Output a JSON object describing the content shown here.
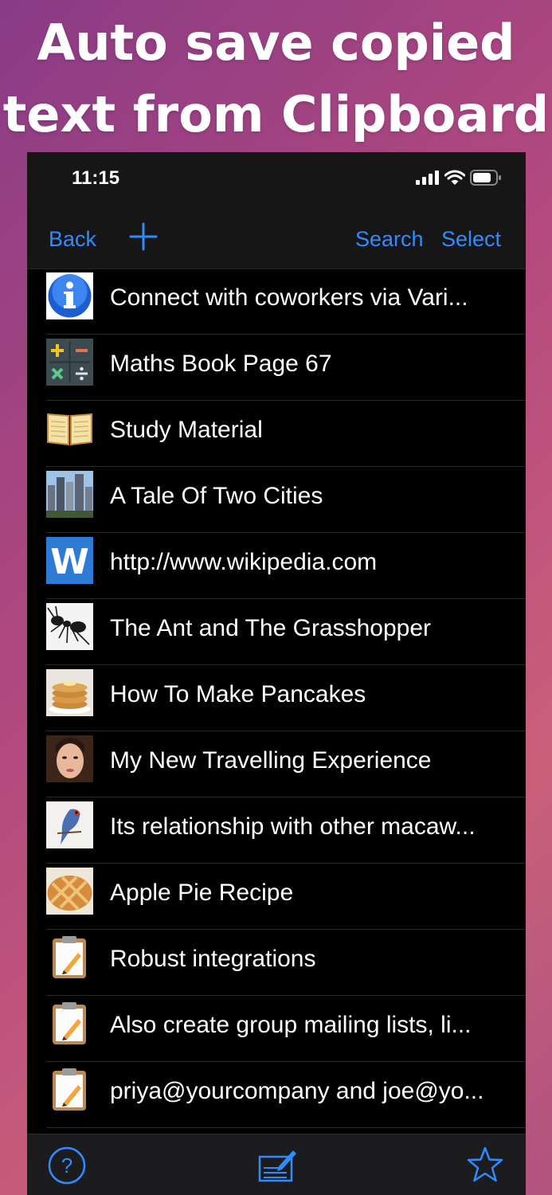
{
  "headline": {
    "line1": "Auto save copied",
    "line2": "text from Clipboard"
  },
  "status_bar": {
    "time": "11:15",
    "icons": [
      "signal-icon",
      "wifi-icon",
      "battery-icon"
    ]
  },
  "nav": {
    "back_label": "Back",
    "add_icon": "plus-icon",
    "search_label": "Search",
    "select_label": "Select"
  },
  "list": {
    "items": [
      {
        "label": "Connect with coworkers via Vari...",
        "icon": "info-icon"
      },
      {
        "label": "Maths Book Page 67",
        "icon": "calculator-icon"
      },
      {
        "label": "Study Material",
        "icon": "open-book-icon"
      },
      {
        "label": "A Tale Of Two Cities",
        "icon": "city-photo"
      },
      {
        "label": "http://www.wikipedia.com",
        "icon": "wikipedia-icon"
      },
      {
        "label": "The Ant and The Grasshopper",
        "icon": "ant-photo"
      },
      {
        "label": "How To Make Pancakes",
        "icon": "pancakes-photo"
      },
      {
        "label": "My New Travelling Experience",
        "icon": "woman-photo"
      },
      {
        "label": "Its relationship with other macaw...",
        "icon": "macaw-photo"
      },
      {
        "label": "Apple Pie Recipe",
        "icon": "apple-pie-photo"
      },
      {
        "label": "Robust integrations",
        "icon": "clipboard-icon"
      },
      {
        "label": "Also create group mailing lists, li...",
        "icon": "clipboard-icon"
      },
      {
        "label": "priya@yourcompany and joe@yo...",
        "icon": "clipboard-icon"
      }
    ]
  },
  "tab_bar": {
    "items": [
      "help-icon",
      "compose-icon",
      "star-icon"
    ]
  },
  "colors": {
    "accent": "#2f8cff",
    "background_gradient_start": "#8a3b86",
    "background_gradient_end": "#c9607a",
    "list_background": "#000000",
    "bar_background": "#161616"
  }
}
